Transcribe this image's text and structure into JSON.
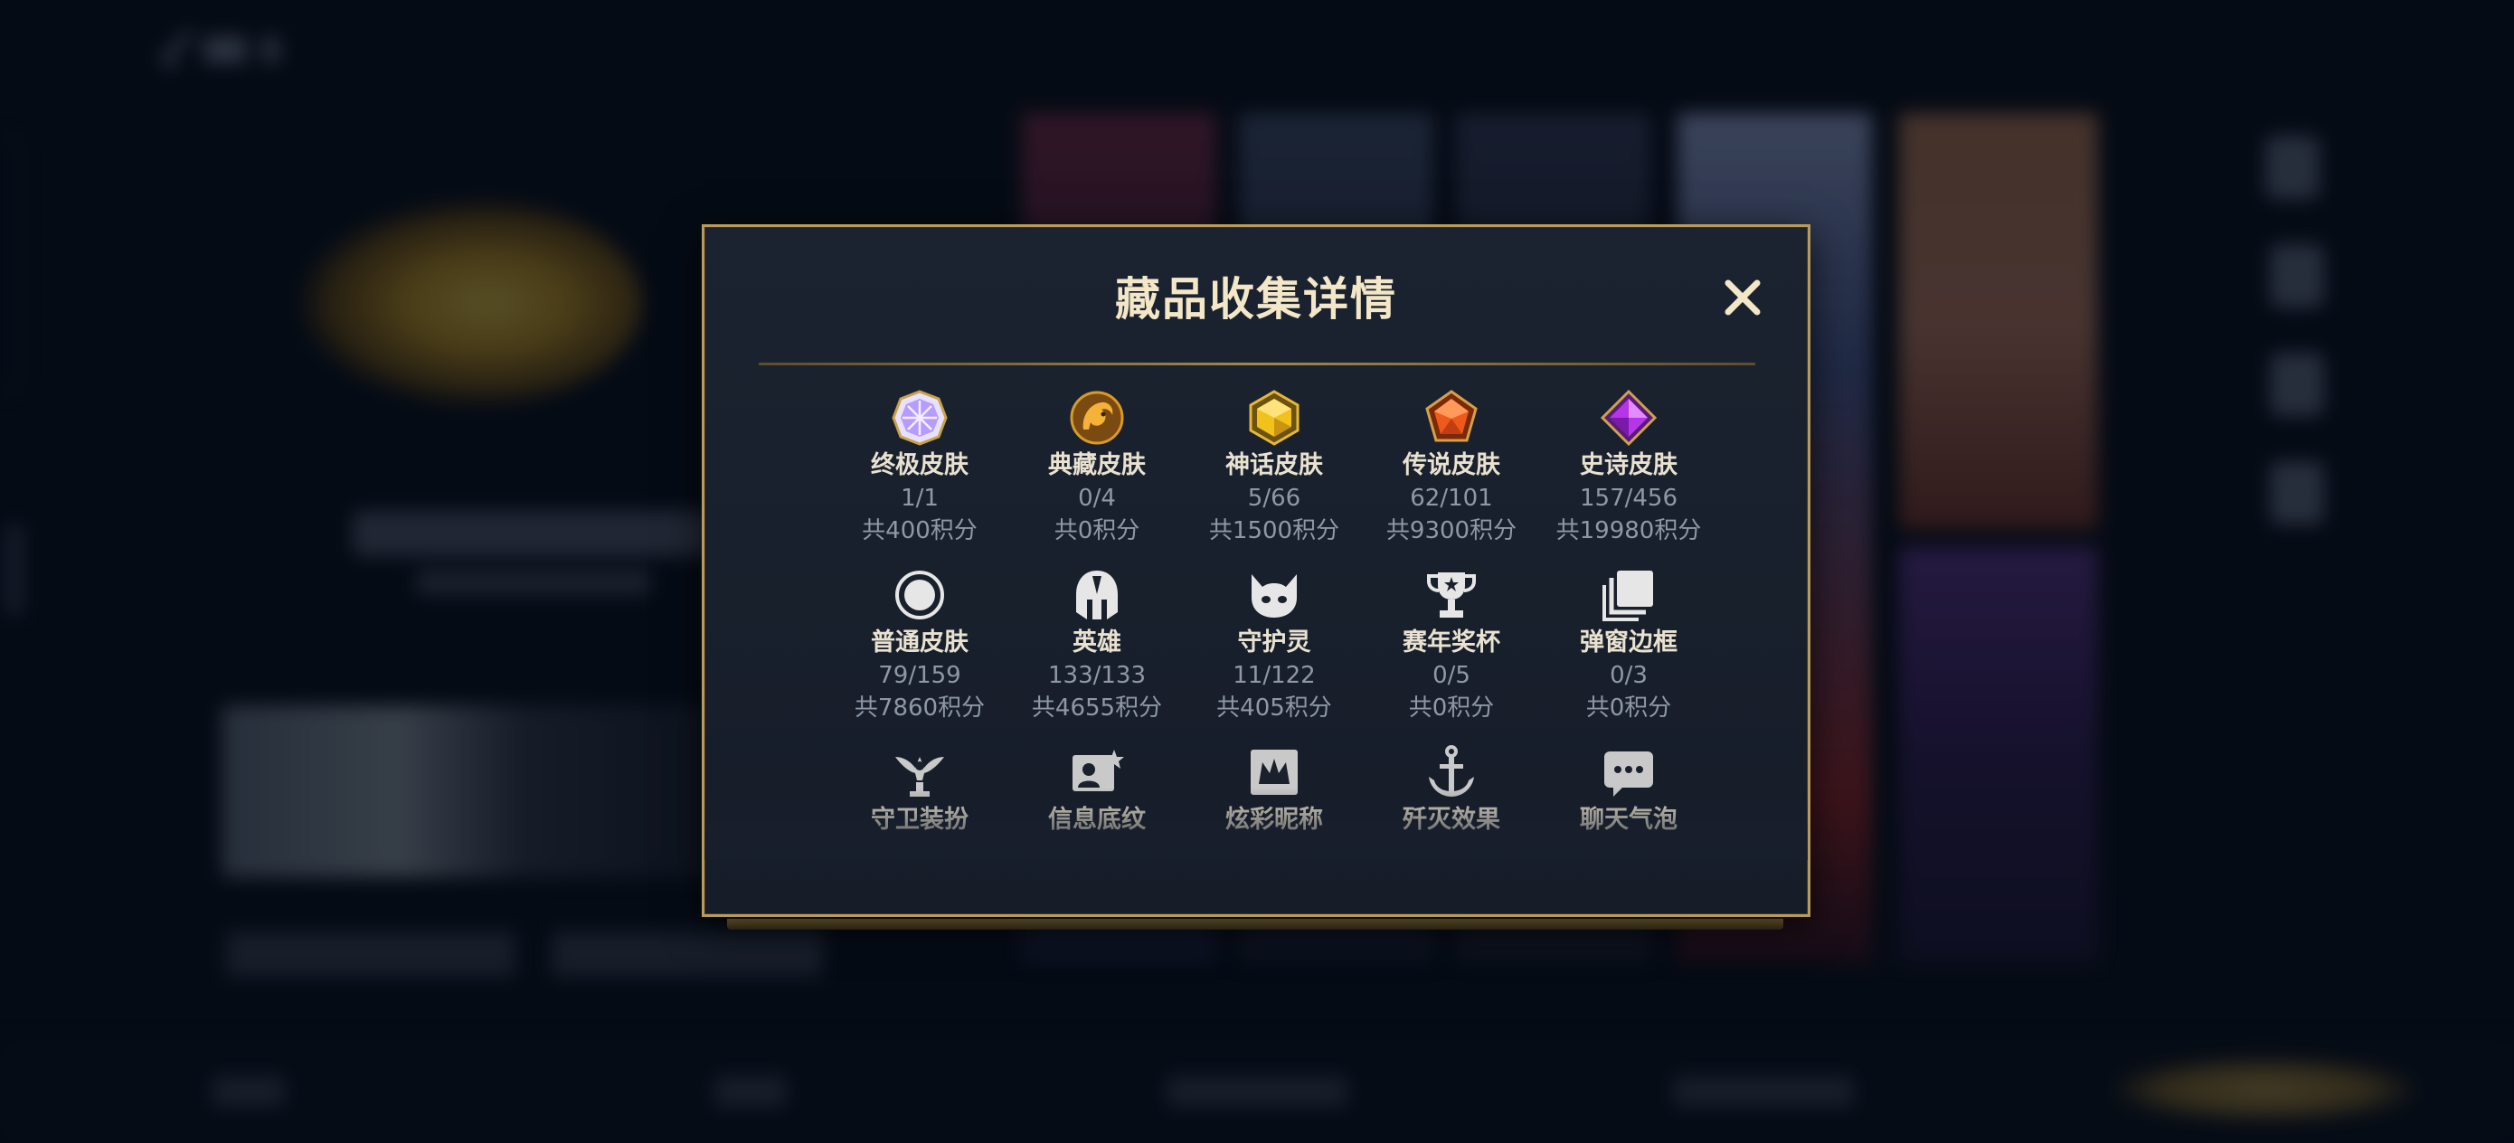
{
  "modal": {
    "title": "藏品收集详情",
    "close_label": "✕",
    "items": [
      {
        "name": "终极皮肤",
        "count": "1/1",
        "points": "共400积分",
        "icon": "ultimate-skin-icon",
        "color": "#b79cff"
      },
      {
        "name": "典藏皮肤",
        "count": "0/4",
        "points": "共0积分",
        "icon": "legacy-skin-icon",
        "color": "#f0a928"
      },
      {
        "name": "神话皮肤",
        "count": "5/66",
        "points": "共1500积分",
        "icon": "mythic-skin-icon",
        "color": "#f2c21c"
      },
      {
        "name": "传说皮肤",
        "count": "62/101",
        "points": "共9300积分",
        "icon": "legendary-skin-icon",
        "color": "#ee5a1c"
      },
      {
        "name": "史诗皮肤",
        "count": "157/456",
        "points": "共19980积分",
        "icon": "epic-skin-icon",
        "color": "#b635e8"
      },
      {
        "name": "普通皮肤",
        "count": "79/159",
        "points": "共7860积分",
        "icon": "standard-skin-icon",
        "color": "#e6e6e6"
      },
      {
        "name": "英雄",
        "count": "133/133",
        "points": "共4655积分",
        "icon": "champion-helmet-icon",
        "color": "#e6e6e6"
      },
      {
        "name": "守护灵",
        "count": "11/122",
        "points": "共405积分",
        "icon": "guardian-spirit-icon",
        "color": "#e6e6e6"
      },
      {
        "name": "赛年奖杯",
        "count": "0/5",
        "points": "共0积分",
        "icon": "trophy-icon",
        "color": "#e6e6e6"
      },
      {
        "name": "弹窗边框",
        "count": "0/3",
        "points": "共0积分",
        "icon": "popup-frame-icon",
        "color": "#e6e6e6"
      },
      {
        "name": "守卫装扮",
        "icon": "ward-skin-icon",
        "color": "#c9c9c9"
      },
      {
        "name": "信息底纹",
        "icon": "info-card-icon",
        "color": "#c9c9c9"
      },
      {
        "name": "炫彩昵称",
        "icon": "color-nickname-icon",
        "color": "#c9c9c9"
      },
      {
        "name": "歼灭效果",
        "icon": "kill-effect-icon",
        "color": "#c9c9c9"
      },
      {
        "name": "聊天气泡",
        "icon": "chat-bubble-icon",
        "color": "#c9c9c9"
      }
    ]
  }
}
